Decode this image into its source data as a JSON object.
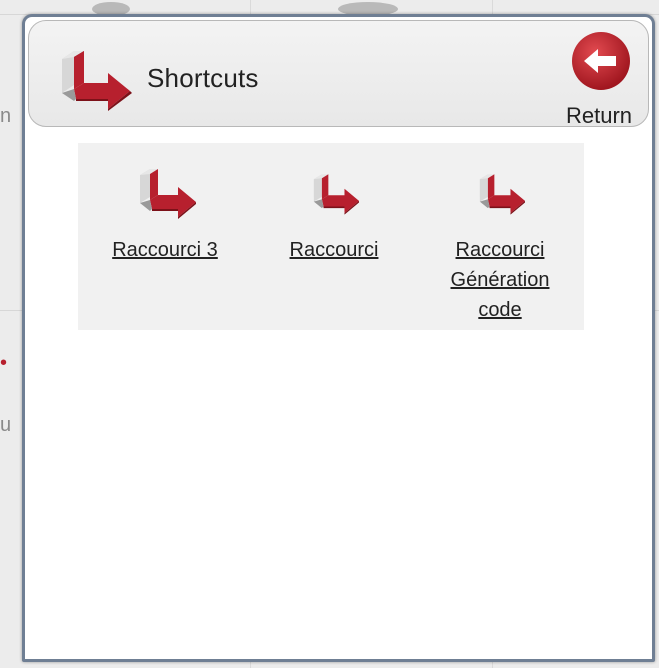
{
  "header": {
    "icon": "shortcut-arrow-icon",
    "title": "Shortcuts",
    "return_label": "Return",
    "return_icon": "back-arrow-icon"
  },
  "shortcuts": [
    {
      "label": "Raccourci 3",
      "icon": "shortcut-arrow-icon"
    },
    {
      "label": "Raccourci",
      "icon": "shortcut-arrow-icon"
    },
    {
      "label_lines": [
        "Raccourci",
        "Génération",
        "code"
      ],
      "icon": "shortcut-arrow-icon"
    }
  ],
  "colors": {
    "accent_red": "#b7202e",
    "popup_border": "#6f7f94",
    "panel_bg": "#f1f1f1"
  }
}
